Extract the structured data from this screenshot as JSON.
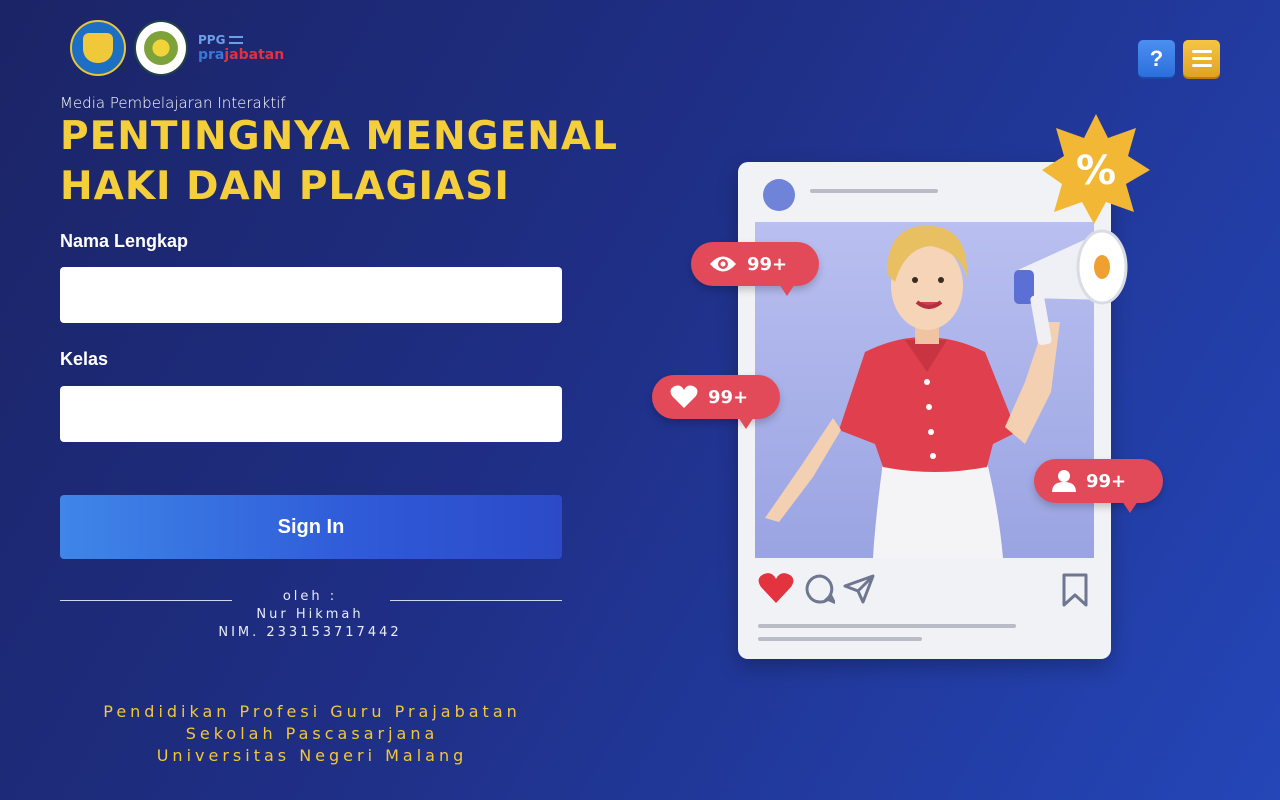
{
  "header": {
    "logos": [
      "kemdikbud-logo",
      "um-logo"
    ],
    "ppg_logo": {
      "top": "PPG",
      "bottom_prefix": "pra",
      "bottom_suffix": "jabatan"
    },
    "help_label": "?",
    "colors": {
      "help": "#3b7de6",
      "menu": "#f0b535"
    }
  },
  "hero": {
    "subtitle": "Media Pembelajaran Interaktif",
    "title_line1": "PENTINGNYA MENGENAL",
    "title_line2": "HAKI DAN PLAGIASI"
  },
  "form": {
    "name_label": "Nama Lengkap",
    "name_value": "",
    "class_label": "Kelas",
    "class_value": "",
    "signin_label": "Sign In"
  },
  "credits": {
    "by": "oleh :",
    "author": "Nur Hikmah",
    "nim": "NIM. 233153717442"
  },
  "institution": {
    "line1": "Pendidikan Profesi Guru Prajabatan",
    "line2": "Sekolah Pascasarjana",
    "line3": "Universitas Negeri Malang"
  },
  "illustration": {
    "views": "99+",
    "likes": "99+",
    "followers": "99+",
    "badge": "%",
    "accent_color": "#e24a5a",
    "title_color": "#f5cf3a"
  }
}
